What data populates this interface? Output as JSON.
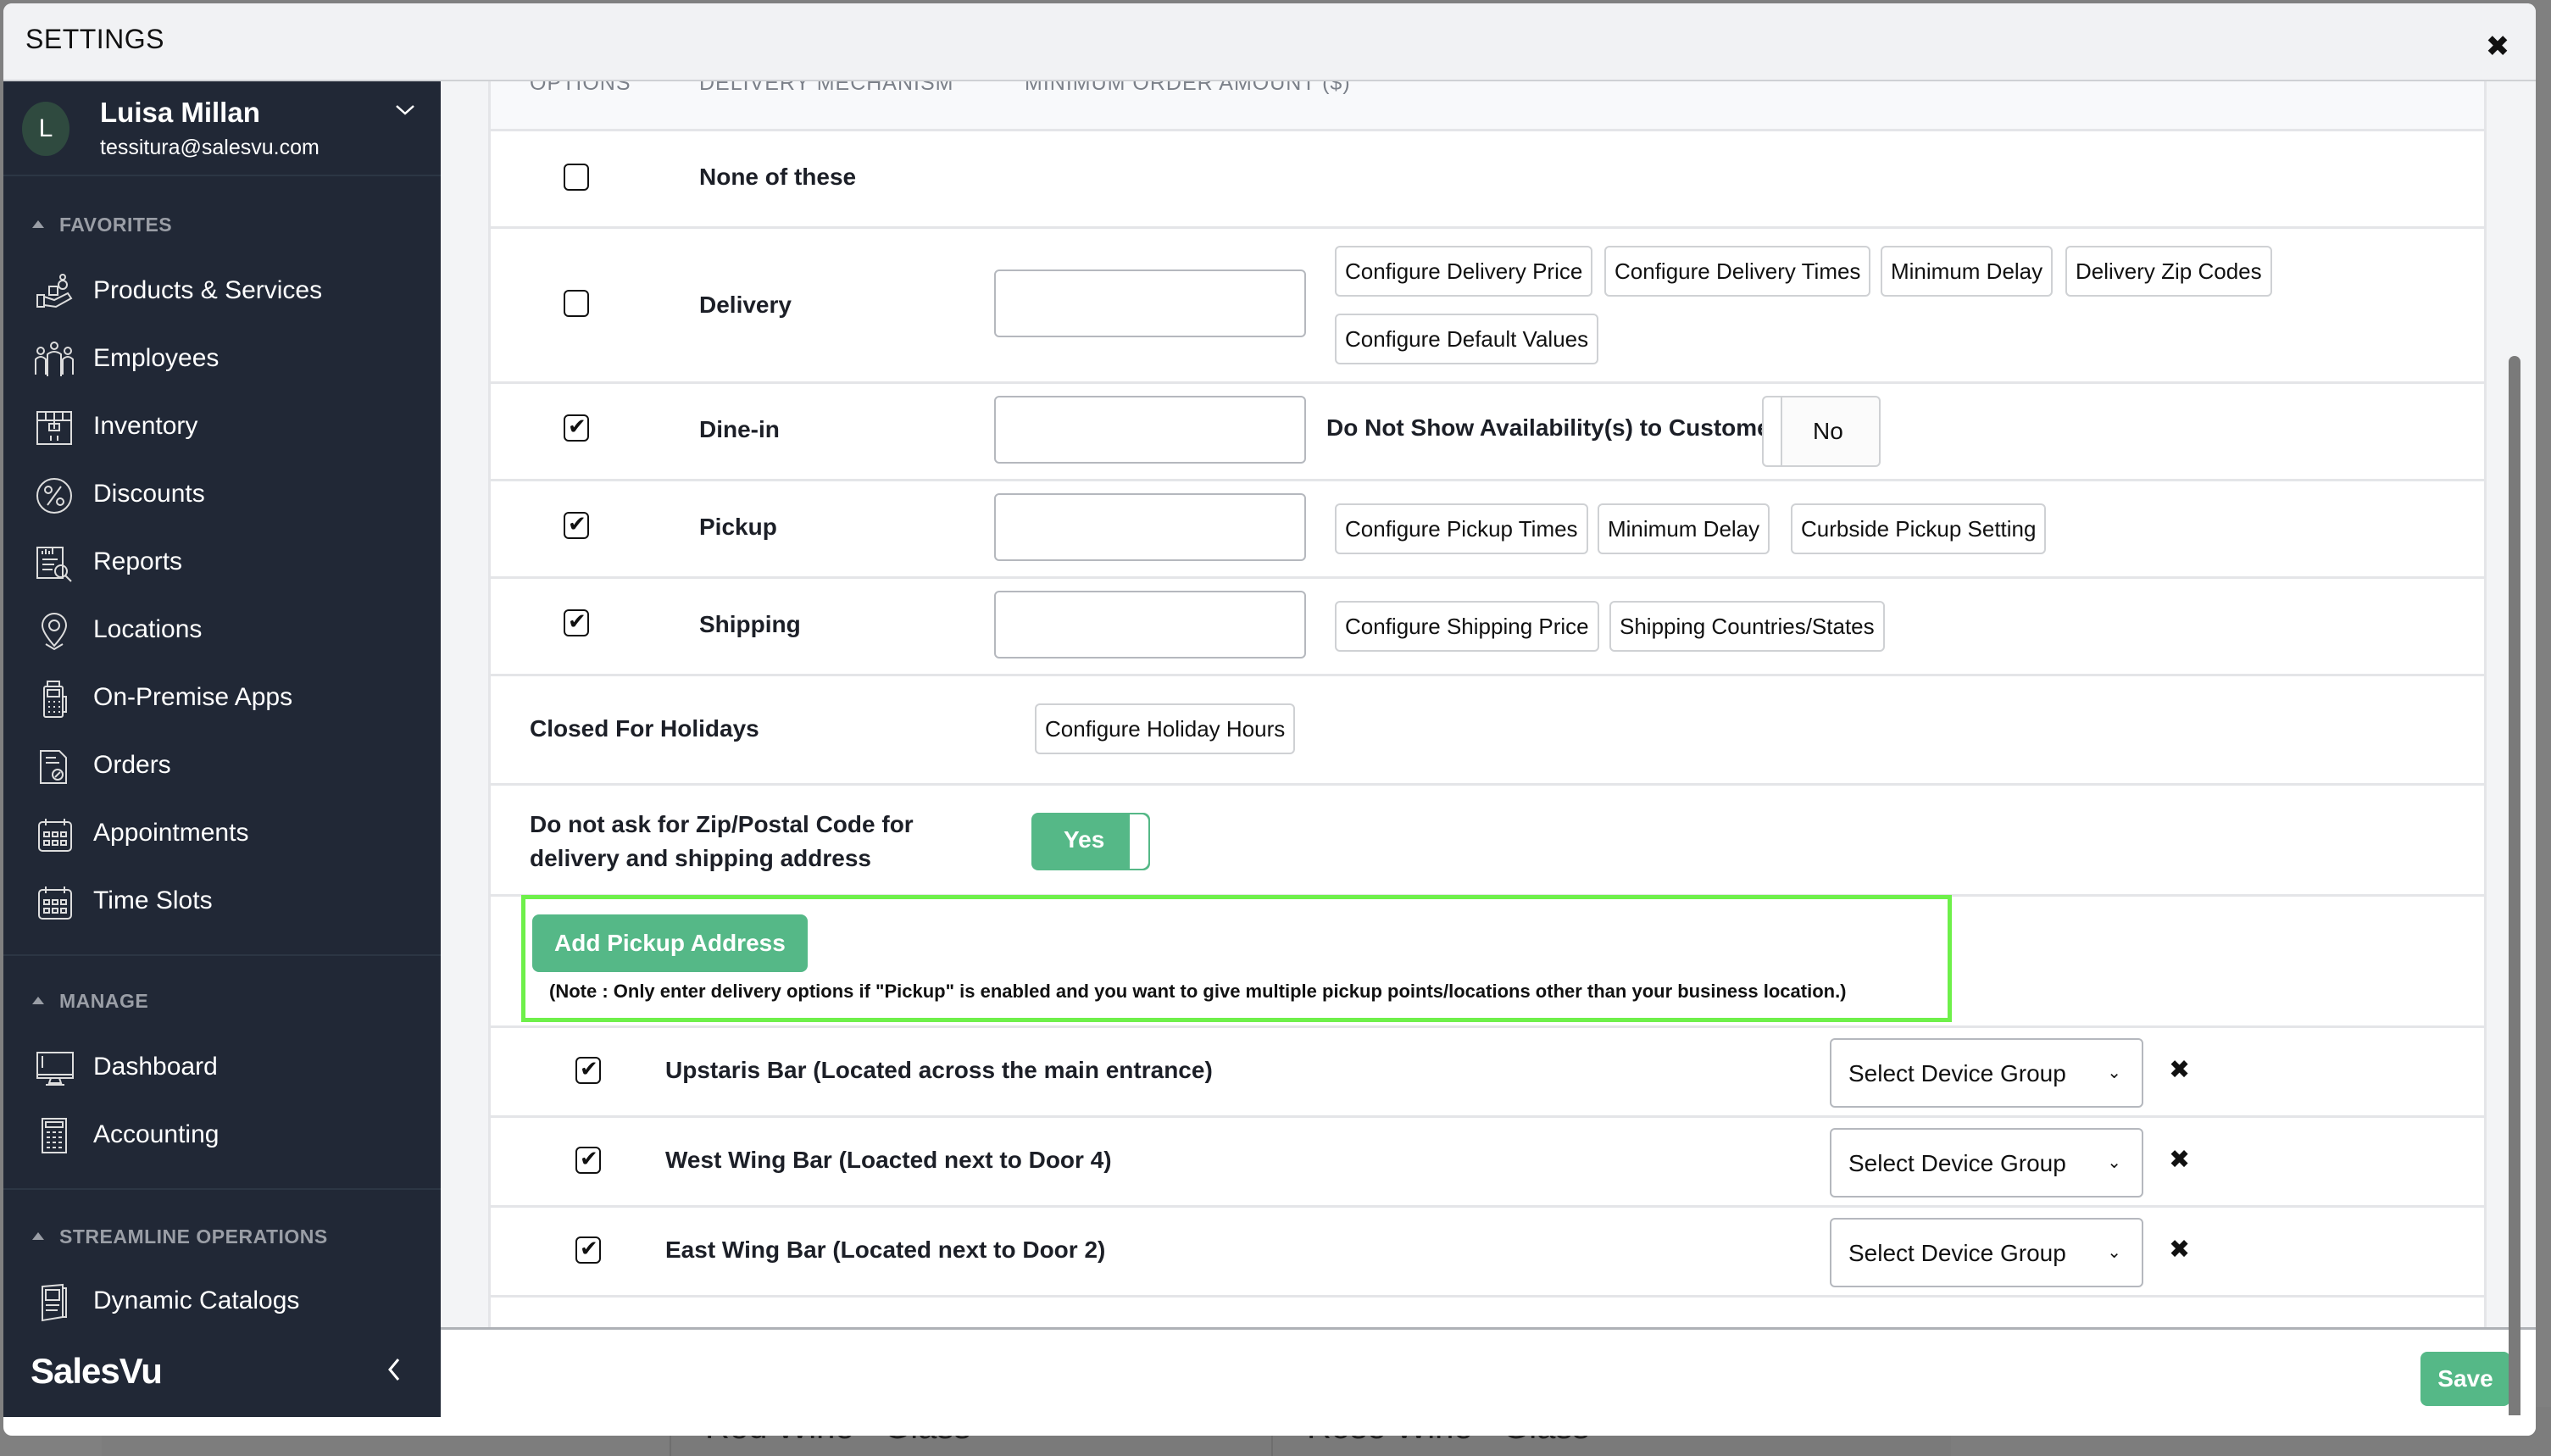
{
  "modal": {
    "title": "SETTINGS",
    "close_icon": "close-icon"
  },
  "user": {
    "initial": "L",
    "name": "Luisa Millan",
    "email": "tessitura@salesvu.com"
  },
  "sidebar": {
    "sections": [
      {
        "title": "FAVORITES",
        "items": [
          {
            "label": "Products & Services",
            "icon": "products-icon"
          },
          {
            "label": "Employees",
            "icon": "employees-icon"
          },
          {
            "label": "Inventory",
            "icon": "inventory-icon"
          },
          {
            "label": "Discounts",
            "icon": "discounts-icon"
          },
          {
            "label": "Reports",
            "icon": "reports-icon"
          },
          {
            "label": "Locations",
            "icon": "location-pin-icon"
          },
          {
            "label": "On-Premise Apps",
            "icon": "pos-terminal-icon"
          },
          {
            "label": "Orders",
            "icon": "orders-icon"
          },
          {
            "label": "Appointments",
            "icon": "calendar-icon"
          },
          {
            "label": "Time Slots",
            "icon": "calendar-icon"
          }
        ]
      },
      {
        "title": "MANAGE",
        "items": [
          {
            "label": "Dashboard",
            "icon": "monitor-icon"
          },
          {
            "label": "Accounting",
            "icon": "calculator-icon"
          }
        ]
      },
      {
        "title": "STREAMLINE OPERATIONS",
        "items": [
          {
            "label": "Dynamic Catalogs",
            "icon": "catalog-icon"
          }
        ]
      }
    ],
    "brand": "SalesVu"
  },
  "table": {
    "headers": [
      "OPTIONS",
      "DELIVERY MECHANISM",
      "MINIMUM ORDER AMOUNT ($)"
    ],
    "rows": [
      {
        "label": "None of these",
        "checked": false
      },
      {
        "label": "Delivery",
        "checked": false,
        "amount": "",
        "buttons": [
          "Configure Delivery Price",
          "Configure Delivery Times",
          "Minimum Delay",
          "Delivery Zip Codes",
          "Configure Default Values"
        ]
      },
      {
        "label": "Dine-in",
        "checked": true,
        "amount": "",
        "availability_label": "Do Not Show Availability(s) to Customer",
        "availability_toggle": "No"
      },
      {
        "label": "Pickup",
        "checked": true,
        "amount": "",
        "buttons": [
          "Configure Pickup Times",
          "Minimum Delay",
          "Curbside Pickup Setting"
        ]
      },
      {
        "label": "Shipping",
        "checked": true,
        "amount": "",
        "buttons": [
          "Configure Shipping Price",
          "Shipping Countries/States"
        ]
      }
    ]
  },
  "holidays": {
    "label": "Closed For Holidays",
    "button": "Configure Holiday Hours"
  },
  "zip_setting": {
    "label_line1": "Do not ask for Zip/Postal Code for",
    "label_line2": "delivery and shipping address",
    "toggle": "Yes"
  },
  "pickup_address": {
    "button": "Add Pickup Address",
    "note": "(Note : Only enter delivery options if \"Pickup\" is enabled and you want to give multiple pickup points/locations other than your business location.)",
    "highlight_color": "#6ef04a",
    "locations": [
      {
        "name": "Upstaris Bar (Located across the main entrance)",
        "checked": true,
        "device_group": "Select Device Group"
      },
      {
        "name": "West Wing Bar (Loacted next to Door 4)",
        "checked": true,
        "device_group": "Select Device Group"
      },
      {
        "name": "East Wing Bar (Located next to Door 2)",
        "checked": true,
        "device_group": "Select Device Group"
      }
    ]
  },
  "footer": {
    "save": "Save"
  },
  "background": {
    "items": [
      "Red Wine - Glass",
      "Rose Wine - Glass"
    ]
  },
  "colors": {
    "accent": "#55b887",
    "sidebar_bg": "#212836",
    "highlight": "#6ef04a"
  }
}
